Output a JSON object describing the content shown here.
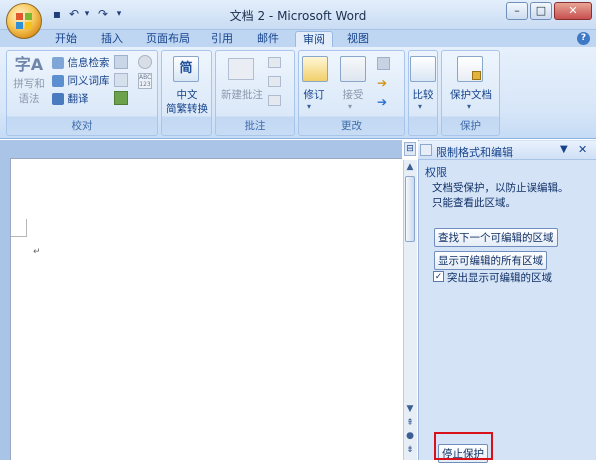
{
  "window": {
    "title": "文档 2 - Microsoft Word",
    "controls": {
      "minimize": "–",
      "restore": "□",
      "close": "✕"
    }
  },
  "quick_access": {
    "save": "▪",
    "undo": "↶",
    "dropdown": "▾",
    "redo": "↷",
    "customize": "▾"
  },
  "tabs": [
    {
      "label": "开始"
    },
    {
      "label": "插入"
    },
    {
      "label": "页面布局"
    },
    {
      "label": "引用"
    },
    {
      "label": "邮件"
    },
    {
      "label": "审阅",
      "active": true
    },
    {
      "label": "视图"
    }
  ],
  "help": "?",
  "ribbon": {
    "proofing": {
      "group_label": "校对",
      "spelling": {
        "line1": "拼写和",
        "line2": "语法"
      },
      "research": "信息检索",
      "thesaurus": "同义词库",
      "translate": "翻译"
    },
    "chinese_conversion": {
      "line1": "中文",
      "line2": "简繁转换"
    },
    "comments": {
      "group_label": "批注",
      "new_comment": "新建批注"
    },
    "tracking": {
      "group_label": "更改",
      "track_changes": "修订",
      "accept": "接受"
    },
    "compare": {
      "label": "比较"
    },
    "protect": {
      "group_label": "保护",
      "protect_document": "保护文档"
    }
  },
  "task_pane": {
    "title": "限制格式和编辑",
    "section": "权限",
    "info_line1": "文档受保护，以防止误编辑。",
    "info_line2": "只能查看此区域。",
    "find_next_button": "查找下一个可编辑的区域",
    "show_all_button": "显示可编辑的所有区域",
    "highlight_checkbox": {
      "label": "突出显示可编辑的区域",
      "checked": true,
      "mark": "✓"
    },
    "stop_protection_button": "停止保护"
  },
  "document": {
    "paragraph_mark": "↵"
  },
  "colors": {
    "accent": "#15428b",
    "highlight": "#d8121a"
  }
}
